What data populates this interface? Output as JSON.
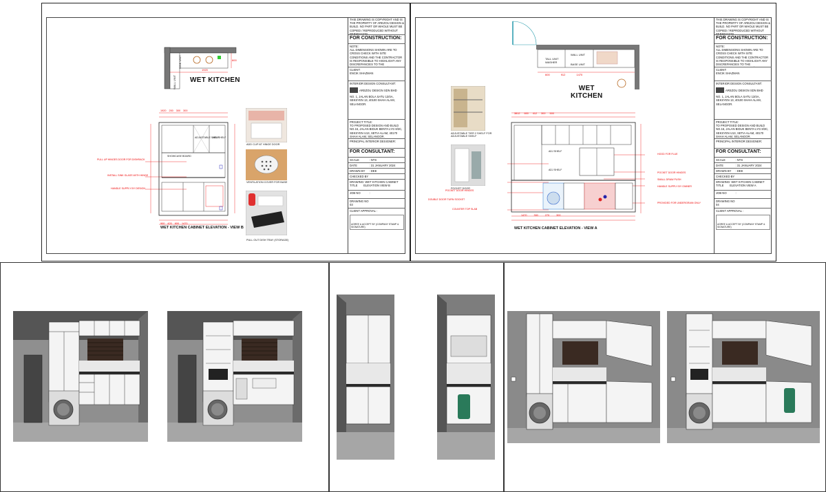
{
  "left_sheet": {
    "copyright": "THIS DRAWING IS COPYRIGHT AND IS THE PROPERTY OF AREZOU DESIGN & BUILD. NO PART OR WHOLE MUST BE COPIED / REPRODUCED WITHOUT PERMISSION.",
    "for_construction": "FOR CONSTRUCTION:",
    "note_label": "NOTE:",
    "note_text": "ALL DIMENSIONS SHOWN ARE TO CROSS CHECK WITH SITE CONDITIONS AND THE CONTRACTOR IS RESPONSIBLE TO HIGHLIGHT ANY DISCREPANCIES TO THE SUPERVISING ARCHITECT / DESIGNER BEFORE ANY WORK IS CARRIED OUT.",
    "client_label": "CLIENT:",
    "client_name": "ENCIK SHAZMAN",
    "consultant_label": "INTERIOR DESIGN CONSULTANT:",
    "consultant_logo": "AREZOU DESIGN SDN BHD",
    "address": "NO. 1, JALAN BOLA SATU 13/4A, SEKSYEN 13, 40100 SHAH ALAM, SELANGOR.",
    "project_label": "PROJECT TITLE:",
    "project_title": "TO PROPOSED DESIGN AND BUILD NO.16, JALAN BIDUK BENTA LYG 8/3C, SEKSYEN U13, SETIA ALAM, 40170 SHAH ALAM, SELANGOR.",
    "principal": "PRINCIPAL INTERIOR DESIGNER:",
    "for_consultant": "FOR CONSULTANT:",
    "scale_label": "SCALE",
    "scale_value": ": NTS",
    "date_label": "DATE",
    "date_value": ": 31 JANUARY 2024",
    "drawn_label": "DRAWN BY",
    "drawn_value": ": DEE",
    "checked_label": "CHECKED BY",
    "drawing_title_label": "DRAWING TITLE",
    "drawing_title_value": ": WET KITCHEN CABINET ELEVATION VIEW B",
    "job_label": "JOB NO",
    "job_value": ":",
    "drawing_no_label": "DRAWING NO",
    "drawing_no_value": "03",
    "approval_label": "CLIENT APPROVAL :",
    "approval_text": "AGREE & ACCEPT BY (COMPANY STAMP & SIGNATURE)",
    "plan_title": "WET KITCHEN",
    "plan_label_a": "SINK UNIT",
    "plan_label_b": "WALL UNIT",
    "plan_dim_a": "1920",
    "plan_dim_b": "600",
    "elev_dims_top": [
      "1920",
      "200",
      "300",
      "300",
      "900",
      "420",
      "600",
      "1470"
    ],
    "elev_labels": {
      "shelf_a": "SHOWCASE BOARD",
      "shelf_b": "ADJUSTABLE SHELF",
      "shelf_c": "ADJ SHELF"
    },
    "notes": [
      "PULL UP HINGES DOOR FOR DISHRACK",
      "INSTALL SINK GLASS WITH HINGE",
      "HANDLE SUPPLY BY DESIGN"
    ],
    "elev_caption": "WET KITCHEN CABINET ELEVATION - VIEW B",
    "photo_captions": [
      "ADD CLIP AT HINGE DOOR",
      "VENTILATION COVER FOR BASE",
      "PULL OUT DISH TRAY (STORAGE)"
    ]
  },
  "right_sheet": {
    "copyright": "THIS DRAWING IS COPYRIGHT AND IS THE PROPERTY OF AREZOU DESIGN & BUILD. NO PART OR WHOLE MUST BE COPIED / REPRODUCED WITHOUT PERMISSION.",
    "for_construction": "FOR CONSTRUCTION:",
    "note_label": "NOTE:",
    "note_text": "ALL DIMENSIONS SHOWN ARE TO CROSS CHECK WITH SITE CONDITIONS AND THE CONTRACTOR IS RESPONSIBLE TO HIGHLIGHT ANY DISCREPANCIES TO THE SUPERVISING ARCHITECT / DESIGNER BEFORE ANY WORK IS CARRIED OUT.",
    "client_label": "CLIENT:",
    "client_name": "ENCIK SHAZMAN",
    "consultant_label": "INTERIOR DESIGN CONSULTANT:",
    "consultant_logo": "AREZOU DESIGN SDN BHD",
    "address": "NO. 1, JALAN BOLA SATU 13/4A, SEKSYEN 13, 40100 SHAH ALAM, SELANGOR.",
    "project_label": "PROJECT TITLE:",
    "project_title": "TO PROPOSED DESIGN AND BUILD NO.16, JALAN BIDUK BENTA LYG 8/3C, SEKSYEN U13, SETIA ALAM, 40170 SHAH ALAM, SELANGOR.",
    "principal": "PRINCIPAL INTERIOR DESIGNER:",
    "for_consultant": "FOR CONSULTANT:",
    "scale_label": "SCALE",
    "scale_value": ": NTS",
    "date_label": "DATE",
    "date_value": ": 31 JANUARY 2024",
    "drawn_label": "DRAWN BY",
    "drawn_value": ": DEE",
    "checked_label": "CHECKED BY",
    "drawing_title_label": "DRAWING TITLE",
    "drawing_title_value": ": WET KITCHEN CABINET ELEVATION VIEW A",
    "job_label": "JOB NO",
    "job_value": ":",
    "drawing_no_label": "DRAWING NO",
    "drawing_no_value": "04",
    "approval_label": "CLIENT APPROVAL :",
    "approval_text": "AGREE & ACCEPT BY (COMPANY STAMP & SIGNATURE)",
    "plan_title_line1": "WET",
    "plan_title_line2": "KITCHEN",
    "plan_label_a": "TALL UNIT WASHER",
    "plan_label_b": "WALL UNIT",
    "plan_label_c": "BASE UNIT",
    "plan_dims": [
      "600",
      "912",
      "1470"
    ],
    "elev_dims_top": [
      "3812",
      "600",
      "412",
      "300",
      "500",
      "1470",
      "300",
      "270",
      "300"
    ],
    "elev_labels": {
      "shelf_a": "ADJ SHELF",
      "shelf_b": "ADJ SHELF"
    },
    "notes_right": [
      "HOOD FOR FLUE",
      "POCKET DOOR HINGES",
      "SMALL DRAW PUSH",
      "HANDLE SUPPLY BY OWNER",
      "PROVIDED FOR UNDERGRAIN ONLY"
    ],
    "notes_left": [
      "POCKET DOOR HINGES",
      "DOUBLE DOOR TURN SOCKET",
      "COUNTER TOP SLAB"
    ],
    "elev_caption": "WET KITCHEN CABINET ELEVATION - VIEW A",
    "photo_captions": [
      "ADJUSTABLE TIER 2 SHELF FOR ADJUSTABLE SHELF",
      "POCKET DOOR"
    ]
  },
  "colors": {
    "dimension_red": "#e00000",
    "render_grey": "#4a4a4a",
    "wall_grey": "#8c8c8c",
    "cabinet_white": "#f4f4f4",
    "floor_grey": "#a6a6a6"
  }
}
